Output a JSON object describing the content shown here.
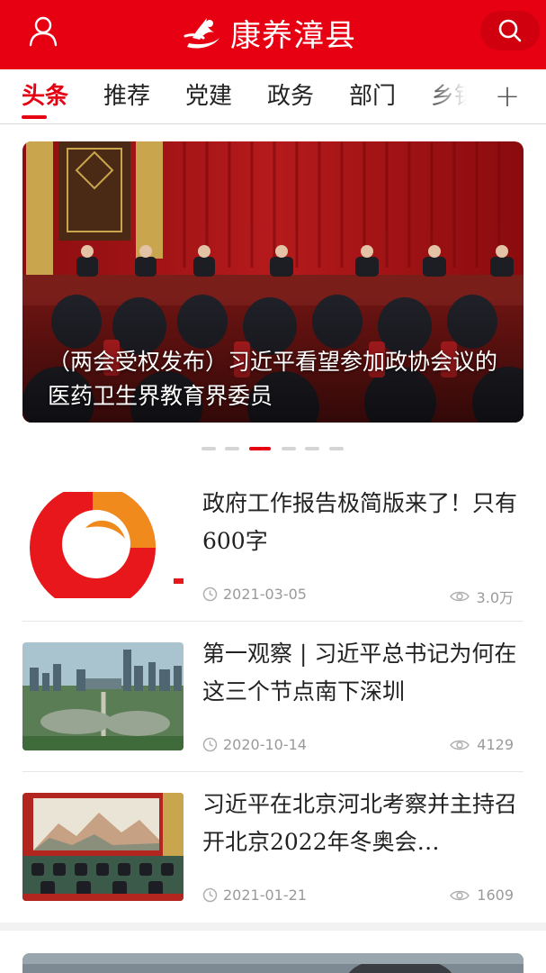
{
  "header": {
    "logo_text": "康养漳县",
    "brand_color": "#e60012",
    "user_icon": "user-icon",
    "search_icon": "search-icon"
  },
  "tabs": [
    {
      "label": "头条",
      "active": true
    },
    {
      "label": "推荐"
    },
    {
      "label": "党建"
    },
    {
      "label": "政务"
    },
    {
      "label": "部门"
    },
    {
      "label": "乡镇"
    }
  ],
  "tabs_add_label": "+",
  "banner": {
    "caption": "（两会受权发布）习近平看望参加政协会议的医药卫生界教育界委员",
    "dot_count": 6,
    "active_dot": 3
  },
  "news": [
    {
      "title": "政府工作报告极简版来了！只有600字",
      "date": "2021-03-05",
      "views": "3.0万"
    },
    {
      "title": "第一观察 | 习近平总书记为何在这三个节点南下深圳",
      "date": "2020-10-14",
      "views": "4129"
    },
    {
      "title": "习近平在北京河北考察并主持召开北京2022年冬奥会…",
      "date": "2021-01-21",
      "views": "1609"
    }
  ]
}
